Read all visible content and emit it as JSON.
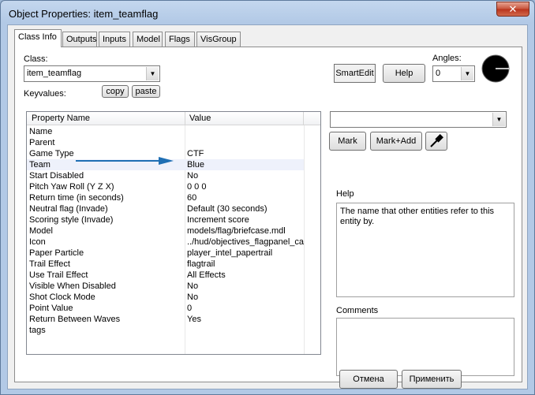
{
  "window": {
    "title": "Object Properties: item_teamflag",
    "close_glyph": "✕"
  },
  "tabs": [
    {
      "label": "Class Info"
    },
    {
      "label": "Outputs"
    },
    {
      "label": "Inputs"
    },
    {
      "label": "Model"
    },
    {
      "label": "Flags"
    },
    {
      "label": "VisGroup"
    }
  ],
  "class_info": {
    "class_label": "Class:",
    "class_value": "item_teamflag",
    "keyvalues_label": "Keyvalues:",
    "copy_label": "copy",
    "paste_label": "paste",
    "smartedit_label": "SmartEdit",
    "help_button_label": "Help",
    "angles_label": "Angles:",
    "angles_value": "0"
  },
  "grid": {
    "col_property": "Property Name",
    "col_value": "Value",
    "rows": [
      {
        "key": "Name",
        "value": ""
      },
      {
        "key": "Parent",
        "value": ""
      },
      {
        "key": "Game Type",
        "value": "CTF"
      },
      {
        "key": "Team",
        "value": "Blue"
      },
      {
        "key": "Start Disabled",
        "value": "No"
      },
      {
        "key": "Pitch Yaw Roll (Y Z X)",
        "value": "0 0 0"
      },
      {
        "key": "Return time (in seconds)",
        "value": "60"
      },
      {
        "key": "Neutral flag (Invade)",
        "value": "Default (30 seconds)"
      },
      {
        "key": "Scoring style (Invade)",
        "value": "Increment score"
      },
      {
        "key": "Model",
        "value": "models/flag/briefcase.mdl"
      },
      {
        "key": "Icon",
        "value": "../hud/objectives_flagpanel_ca"
      },
      {
        "key": "Paper Particle",
        "value": "player_intel_papertrail"
      },
      {
        "key": "Trail Effect",
        "value": "flagtrail"
      },
      {
        "key": "Use Trail Effect",
        "value": "All Effects"
      },
      {
        "key": "Visible When Disabled",
        "value": "No"
      },
      {
        "key": "Shot Clock Mode",
        "value": "No"
      },
      {
        "key": "Point Value",
        "value": "0"
      },
      {
        "key": "Return Between Waves",
        "value": "Yes"
      },
      {
        "key": "tags",
        "value": ""
      }
    ]
  },
  "right_panel": {
    "mark_label": "Mark",
    "mark_add_label": "Mark+Add",
    "help_heading": "Help",
    "help_text": "The name that other entities refer to this entity by.",
    "comments_heading": "Comments"
  },
  "footer": {
    "cancel_label": "Отмена",
    "apply_label": "Применить"
  },
  "icons": {
    "dropdown": "chevron-down-icon",
    "eyedropper": "eyedropper-icon",
    "angle_dial": "angle-dial-icon"
  },
  "colors": {
    "arrow_annotation": "#1f6fb4",
    "selected_row_bg": "#eef1fb"
  }
}
